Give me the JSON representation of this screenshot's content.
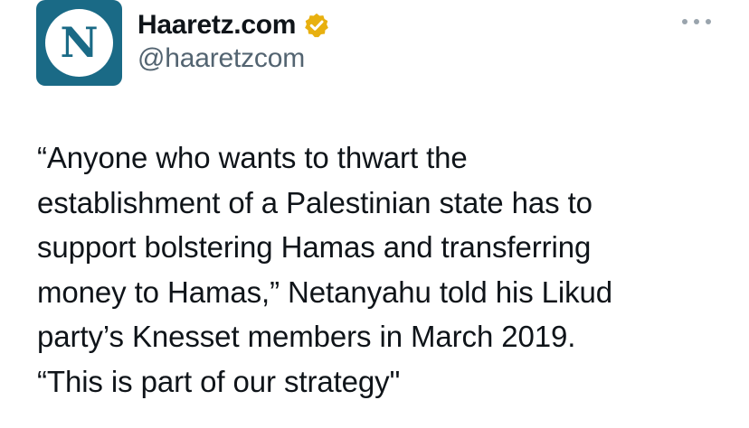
{
  "author": {
    "display_name": "Haaretz.com",
    "handle": "@haaretzcom",
    "avatar_letter": "N",
    "avatar_color": "#1a6a86",
    "verified_icon": "verified-gold-badge-icon",
    "verified_color": "#e8b00f"
  },
  "menu": {
    "icon": "more-horizontal-icon"
  },
  "tweet": {
    "text": "“Anyone who wants to thwart the\nestablishment of a Palestinian state has to\nsupport bolstering Hamas and transferring\nmoney to Hamas,” Netanyahu told his Likud\nparty’s Knesset members in March 2019.\n“This is part of our strategy\""
  }
}
